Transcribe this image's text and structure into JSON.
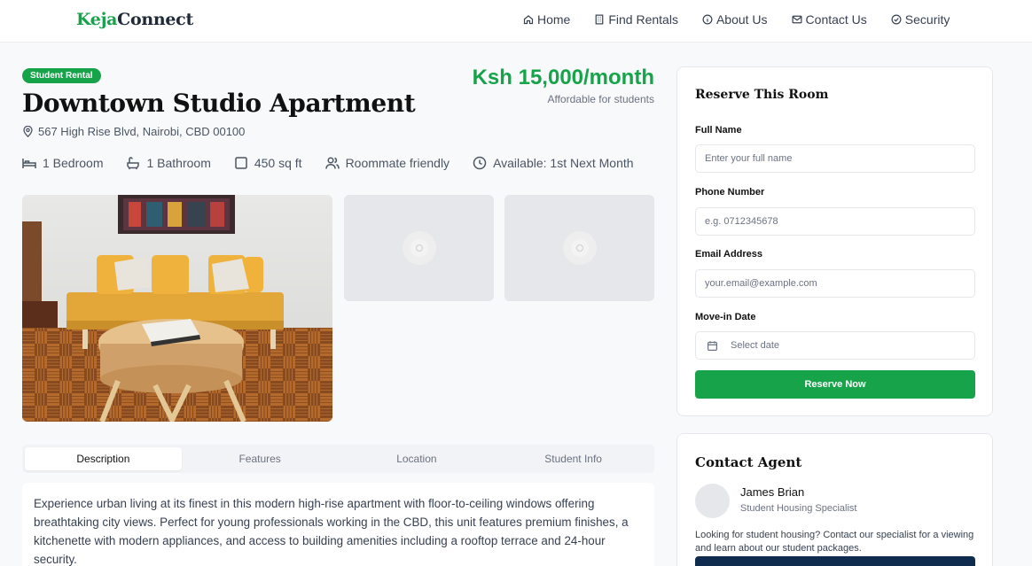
{
  "nav": {
    "logo_part1": "Keja",
    "logo_part2": "Connect",
    "links": [
      "Home",
      "Find Rentals",
      "About Us",
      "Contact Us",
      "Security"
    ]
  },
  "listing": {
    "badge": "Student Rental",
    "title": "Downtown Studio Apartment",
    "address": "567 High Rise Blvd, Nairobi, CBD 00100",
    "price": "Ksh 15,000/month",
    "price_note": "Affordable for students",
    "amenities": [
      "1 Bedroom",
      "1 Bathroom",
      "450 sq ft",
      "Roommate friendly",
      "Available: 1st Next Month"
    ]
  },
  "tabs": [
    "Description",
    "Features",
    "Location",
    "Student Info"
  ],
  "description": "Experience urban living at its finest in this modern high-rise apartment with floor-to-ceiling windows offering breathtaking city views. Perfect for young professionals working in the CBD, this unit features premium finishes, a kitchenette with modern appliances, and access to building amenities including a rooftop terrace and 24-hour security.",
  "reserve": {
    "title": "Reserve This Room",
    "full_name_label": "Full Name",
    "full_name_placeholder": "Enter your full name",
    "phone_label": "Phone Number",
    "phone_placeholder": "e.g. 0712345678",
    "email_label": "Email Address",
    "email_placeholder": "your.email@example.com",
    "move_in_label": "Move-in Date",
    "move_in_placeholder": "Select date",
    "button": "Reserve Now"
  },
  "agent": {
    "title": "Contact Agent",
    "name": "James Brian",
    "role": "Student Housing Specialist",
    "description": "Looking for student housing? Contact our specialist for a viewing and learn about our student packages."
  },
  "colors": {
    "brand_green": "#16a34a",
    "navy": "#0f2c4f"
  }
}
